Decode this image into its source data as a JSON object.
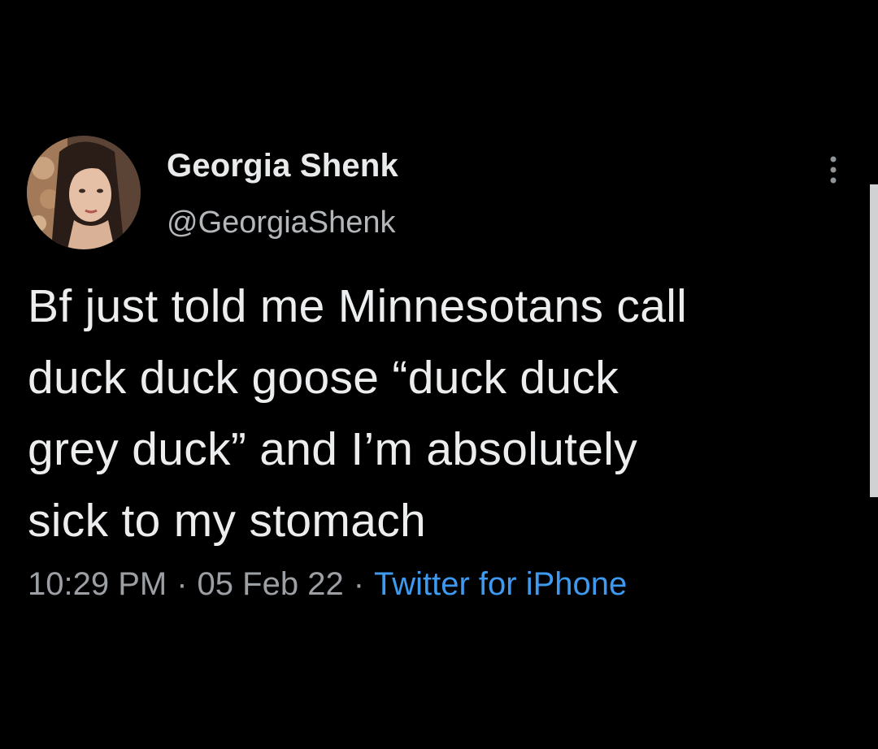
{
  "tweet": {
    "author_name": "Georgia Shenk",
    "author_handle": "@GeorgiaShenk",
    "text_lines": [
      "Bf just told me Minnesotans call",
      "duck duck goose “duck duck",
      "grey duck” and I’m absolutely",
      "sick to my stomach"
    ],
    "time": "10:29 PM",
    "separator": "·",
    "date": "05 Feb 22",
    "source": "Twitter for iPhone"
  },
  "icons": {
    "more": "more-options-icon",
    "avatar": "profile-photo"
  },
  "colors": {
    "background": "#000000",
    "name": "#e9eaeb",
    "handle": "#b3b7ba",
    "body": "#ecedee",
    "meta": "#9ca0a4",
    "link": "#3d9af0"
  }
}
